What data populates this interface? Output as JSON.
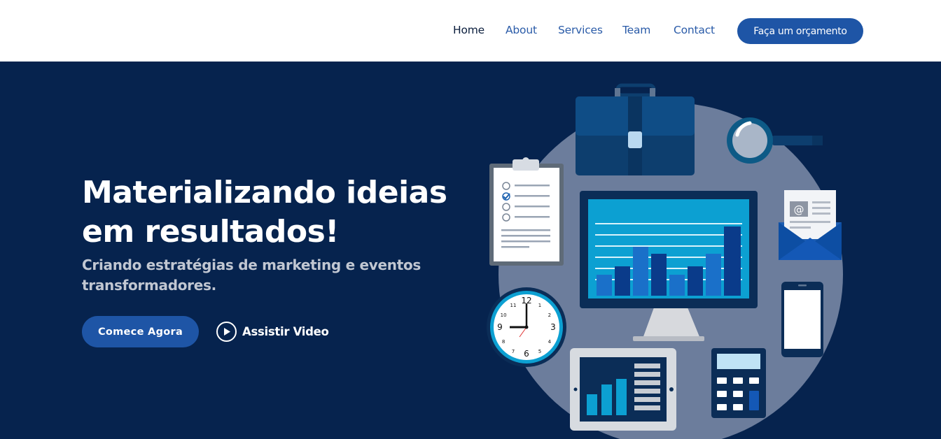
{
  "nav": {
    "items": [
      {
        "label": "Home",
        "active": true
      },
      {
        "label": "About",
        "active": false
      },
      {
        "label": "Services",
        "active": false
      },
      {
        "label": "Team",
        "active": false
      },
      {
        "label": "Contact",
        "active": false
      }
    ],
    "cta_label": "Faça um orçamento"
  },
  "hero": {
    "title_line1": "Materializando ideias",
    "title_line2": "em resultados!",
    "subtitle_line1": "Criando estratégias de marketing e eventos",
    "subtitle_line2": "transformadores.",
    "primary_button": "Comece Agora",
    "video_button": "Assistir Video",
    "play_icon": "play-circle-icon"
  },
  "illustration": {
    "clock_numbers": [
      "12",
      "1",
      "2",
      "3",
      "4",
      "5",
      "6",
      "7",
      "8",
      "9",
      "10",
      "11"
    ],
    "email_symbol": "@",
    "icons": [
      "briefcase-icon",
      "magnifier-icon",
      "clipboard-icon",
      "monitor-chart-icon",
      "envelope-icon",
      "clock-icon",
      "smartphone-icon",
      "tablet-chart-icon",
      "calculator-icon"
    ]
  },
  "colors": {
    "hero_bg": "#06234e",
    "accent": "#1e55a6",
    "nav_link": "#2a5ba8",
    "nav_active": "#0b1e3d"
  }
}
